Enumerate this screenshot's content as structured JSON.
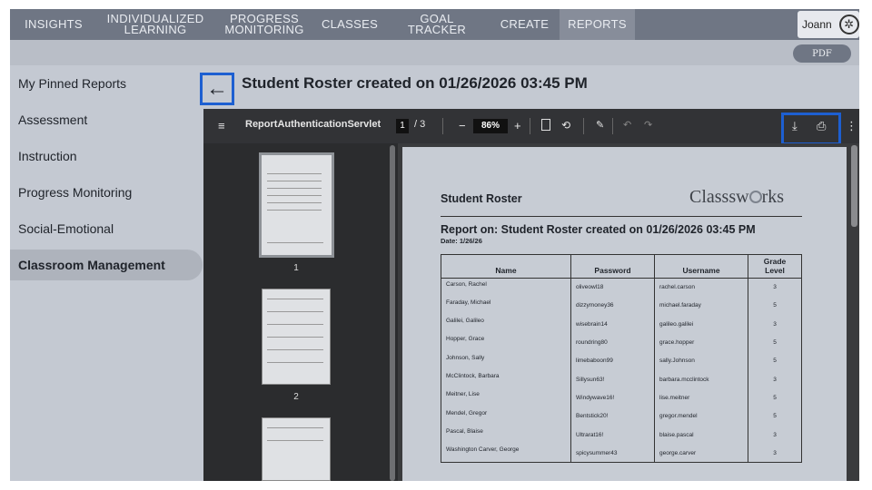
{
  "nav": {
    "items": [
      {
        "label": "INSIGHTS"
      },
      {
        "label1": "INDIVIDUALIZED",
        "label2": "LEARNING"
      },
      {
        "label1": "PROGRESS",
        "label2": "MONITORING"
      },
      {
        "label": "CLASSES"
      },
      {
        "label": "GOAL TRACKER"
      },
      {
        "label": "CREATE"
      },
      {
        "label": "REPORTS"
      }
    ],
    "active": "REPORTS",
    "user_name": "Joann"
  },
  "subbar": {
    "pdf_label": "PDF"
  },
  "sidebar": {
    "items": [
      {
        "label": "My Pinned Reports"
      },
      {
        "label": "Assessment"
      },
      {
        "label": "Instruction"
      },
      {
        "label": "Progress Monitoring"
      },
      {
        "label": "Social-Emotional"
      },
      {
        "label": "Classroom Management"
      }
    ],
    "active": "Classroom Management"
  },
  "title": "Student Roster created on 01/26/2026 03:45 PM",
  "viewer": {
    "doc_name": "ReportAuthenticationServlet",
    "current_page": "1",
    "page_total": "/ 3",
    "zoom": "86%",
    "thumb_labels": [
      "1",
      "2"
    ]
  },
  "report": {
    "heading": "Student Roster",
    "brand": {
      "pre": "Classsw",
      "post": "rks"
    },
    "report_on": "Report on: Student Roster created on 01/26/2026 03:45 PM",
    "date": "Date: 1/26/26",
    "columns": [
      "Name",
      "Password",
      "Username",
      "Grade",
      "Level"
    ],
    "rows": [
      [
        "Carson, Rachel",
        "oliveowl18",
        "rachel.carson",
        "3"
      ],
      [
        "Faraday, Michael",
        "dizzymoney36",
        "michael.faraday",
        "5"
      ],
      [
        "Galilei, Galileo",
        "wisebrain14",
        "galileo.galilei",
        "3"
      ],
      [
        "Hopper, Grace",
        "roundring80",
        "grace.hopper",
        "5"
      ],
      [
        "Johnson, Sally",
        "limebaboon99",
        "sally.Johnson",
        "5"
      ],
      [
        "McClintock, Barbara",
        "Sillysun63!",
        "barbara.mcclintock",
        "3"
      ],
      [
        "Meitner, Lise",
        "Windywave16!",
        "lise.meitner",
        "5"
      ],
      [
        "Mendel, Gregor",
        "Bentstick20!",
        "gregor.mendel",
        "5"
      ],
      [
        "Pascal, Blaise",
        "Ultrarat16!",
        "blaise.pascal",
        "3"
      ],
      [
        "Washington Carver, George",
        "spicysummer43",
        "george.carver",
        "3"
      ]
    ]
  }
}
